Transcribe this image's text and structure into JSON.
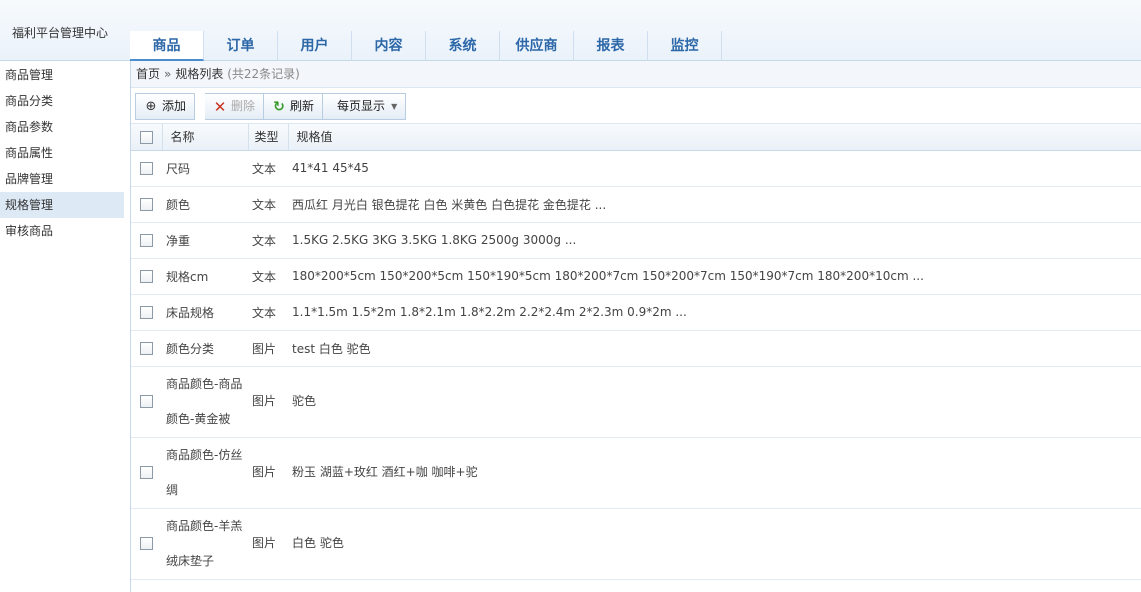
{
  "header": {
    "brand": "福利平台管理中心",
    "tabs": [
      "商品",
      "订单",
      "用户",
      "内容",
      "系统",
      "供应商",
      "报表",
      "监控"
    ],
    "active_tab": "商品"
  },
  "sidebar": {
    "items": [
      "商品管理",
      "商品分类",
      "商品参数",
      "商品属性",
      "品牌管理",
      "规格管理",
      "审核商品"
    ],
    "active": "规格管理"
  },
  "breadcrumb": {
    "home": "首页",
    "separator": "»",
    "current": "规格列表",
    "count": "(共22条记录)"
  },
  "toolbar": {
    "add_label": "添加",
    "delete_label": "删除",
    "refresh_label": "刷新",
    "page_size_label": "每页显示"
  },
  "table": {
    "headers": [
      "名称",
      "类型",
      "规格值"
    ],
    "rows": [
      {
        "name": "尺码",
        "type": "文本",
        "values": "41*41 45*45"
      },
      {
        "name": "颜色",
        "type": "文本",
        "values": "西瓜红 月光白 银色提花 白色 米黄色 白色提花 金色提花 ..."
      },
      {
        "name": "净重",
        "type": "文本",
        "values": "1.5KG 2.5KG 3KG 3.5KG 1.8KG 2500g 3000g ..."
      },
      {
        "name": "规格cm",
        "type": "文本",
        "values": "180*200*5cm 150*200*5cm 150*190*5cm 180*200*7cm 150*200*7cm 150*190*7cm 180*200*10cm ..."
      },
      {
        "name": "床品规格",
        "type": "文本",
        "values": "1.1*1.5m 1.5*2m 1.8*2.1m 1.8*2.2m 2.2*2.4m 2*2.3m 0.9*2m ..."
      },
      {
        "name": "颜色分类",
        "type": "图片",
        "values": "test 白色 驼色"
      },
      {
        "name": "商品颜色-商品颜色-黄金被",
        "type": "图片",
        "values": "驼色"
      },
      {
        "name": "商品颜色-仿丝绸",
        "type": "图片",
        "values": "粉玉 湖蓝+玫红 酒红+咖 咖啡+驼"
      },
      {
        "name": "商品颜色-羊羔绒床垫子",
        "type": "图片",
        "values": "白色 驼色"
      }
    ]
  },
  "colors": {
    "accent": "#2c67a8",
    "sidebar_active": "#dde9f5",
    "delete_icon": "#cc3322",
    "refresh_icon": "#3a9a2a"
  },
  "icons": {
    "add": "plus-circle-icon",
    "delete": "x-icon",
    "refresh": "refresh-icon",
    "dropdown": "caret-down-icon"
  }
}
